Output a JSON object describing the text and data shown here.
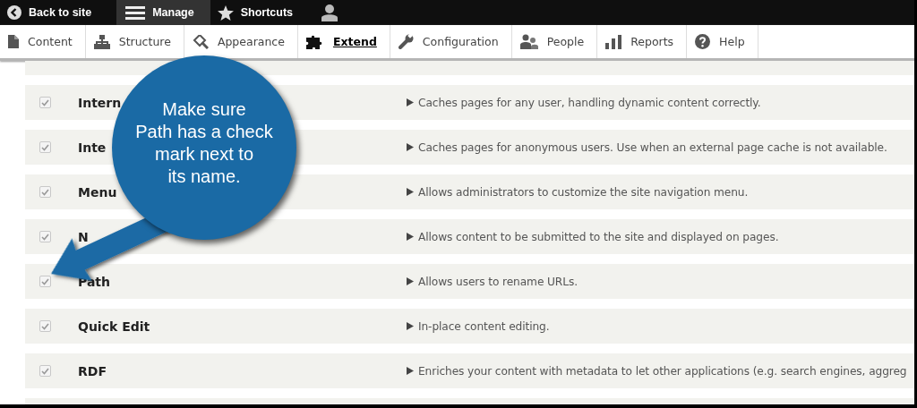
{
  "toolbar": {
    "items": [
      {
        "label": "Back to site",
        "selected": false
      },
      {
        "label": "Manage",
        "selected": true
      },
      {
        "label": "Shortcuts",
        "selected": false
      }
    ]
  },
  "tray": {
    "items": [
      {
        "label": "Content",
        "selected": false
      },
      {
        "label": "Structure",
        "selected": false
      },
      {
        "label": "Appearance",
        "selected": false
      },
      {
        "label": "Extend",
        "selected": true
      },
      {
        "label": "Configuration",
        "selected": false
      },
      {
        "label": "People",
        "selected": false
      },
      {
        "label": "Reports",
        "selected": false
      },
      {
        "label": "Help",
        "selected": false
      }
    ]
  },
  "modules": [
    {
      "name": "Intern",
      "checked": true,
      "description": "Caches pages for any user, handling dynamic content correctly."
    },
    {
      "name": "Inte",
      "checked": true,
      "description": "Caches pages for anonymous users. Use when an external page cache is not available."
    },
    {
      "name": "Menu",
      "checked": true,
      "description": "Allows administrators to customize the site navigation menu."
    },
    {
      "name": "N",
      "checked": true,
      "description": "Allows content to be submitted to the site and displayed on pages."
    },
    {
      "name": "Path",
      "checked": true,
      "description": "Allows users to rename URLs."
    },
    {
      "name": "Quick Edit",
      "checked": true,
      "description": "In-place content editing."
    },
    {
      "name": "RDF",
      "checked": true,
      "description": "Enriches your content with metadata to let other applications (e.g. search engines, aggreg"
    }
  ],
  "callout": {
    "text": "Make sure\nPath has a check\nmark next to\nits name."
  }
}
